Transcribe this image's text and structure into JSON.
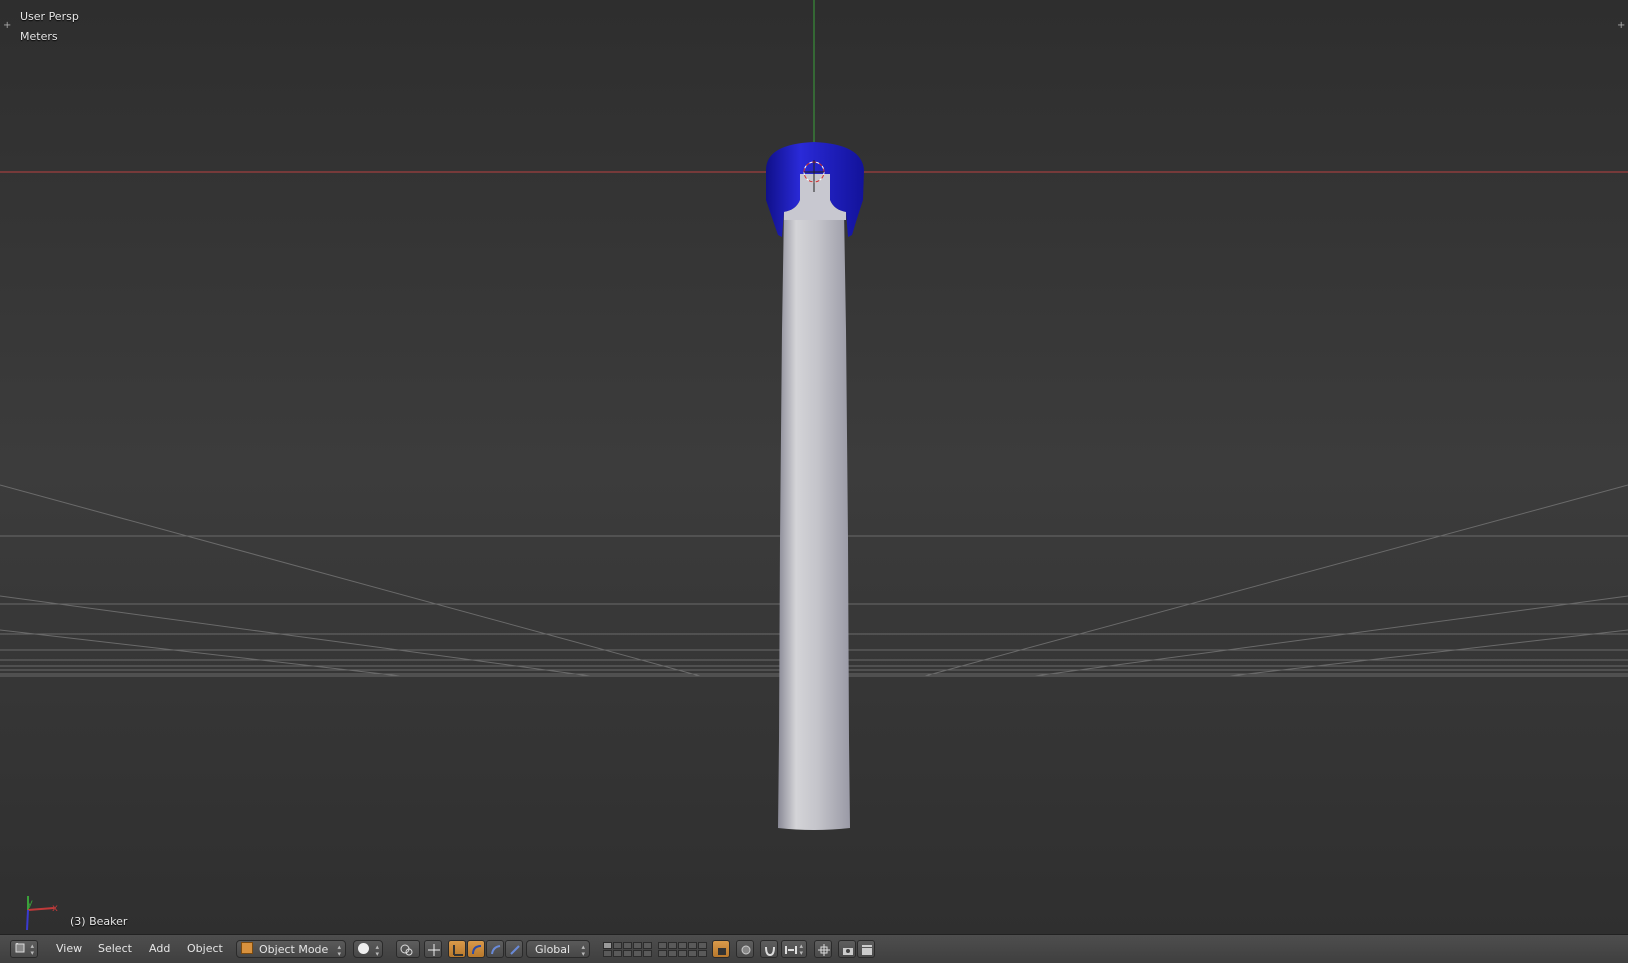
{
  "viewport": {
    "view_name": "User Persp",
    "units": "Meters",
    "object_info": "(3) Beaker",
    "axis_labels": {
      "x": "x",
      "y": "y",
      "z": "z"
    }
  },
  "header": {
    "menus": [
      "View",
      "Select",
      "Add",
      "Object"
    ],
    "mode": "Object Mode",
    "transform_orientation": "Global"
  },
  "colors": {
    "x_axis": "#b84040",
    "y_axis": "#3aa03a",
    "object_blue": "#1a1acc",
    "object_gray": "#c8c8cc",
    "accent": "#d8913d"
  }
}
